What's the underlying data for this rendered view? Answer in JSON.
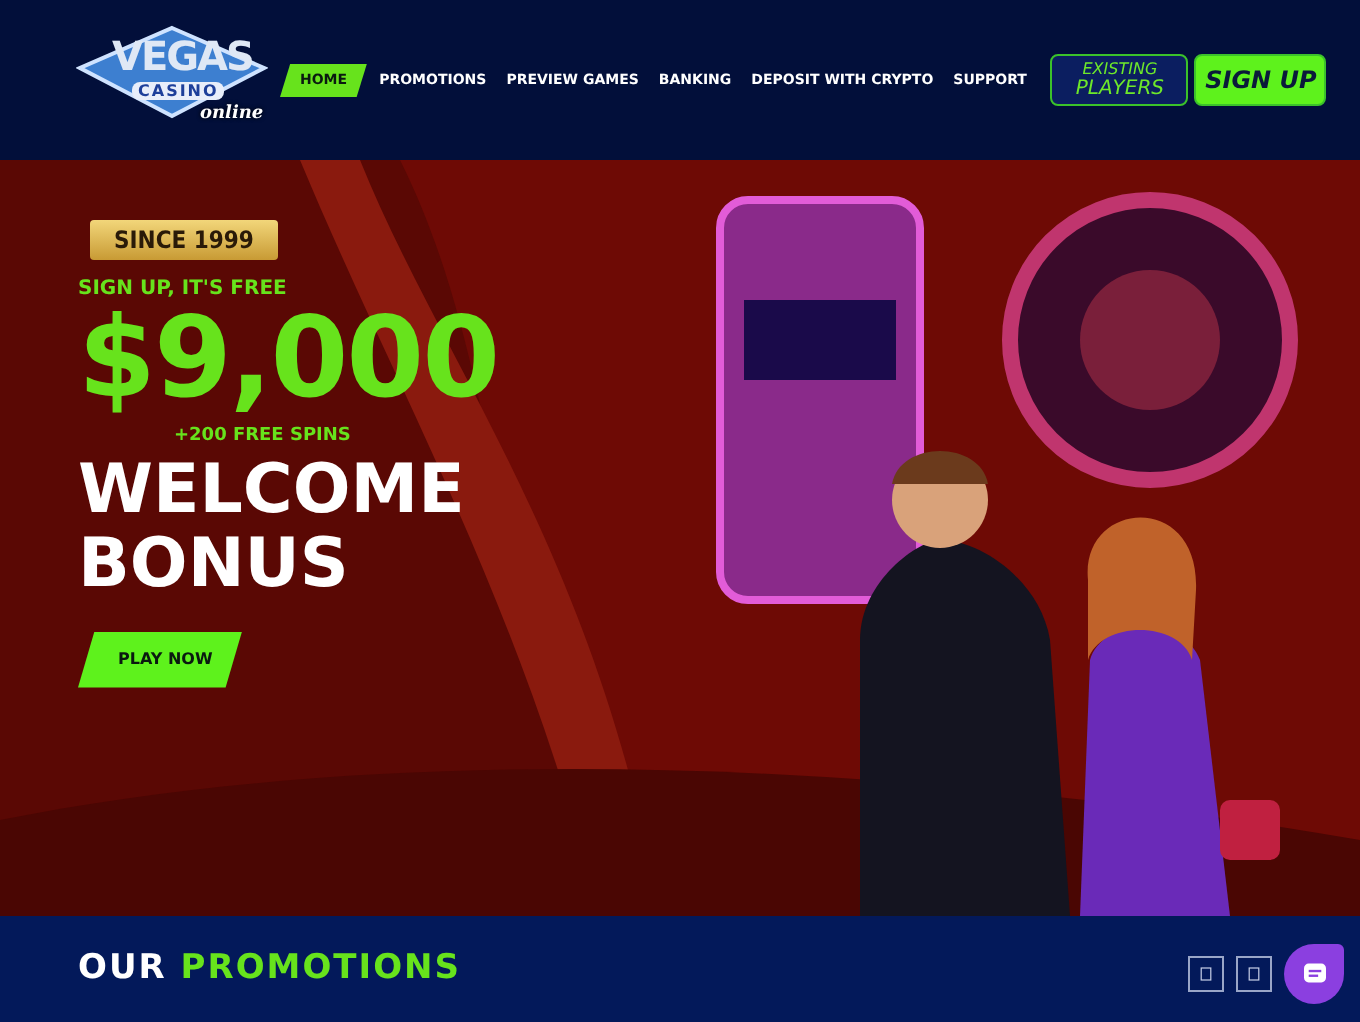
{
  "logo": {
    "word_1": "VEGAS",
    "word_2": "CASINO",
    "word_3": "online"
  },
  "nav": [
    {
      "label": "HOME",
      "selected": true
    },
    {
      "label": "PROMOTIONS",
      "selected": false
    },
    {
      "label": "PREVIEW GAMES",
      "selected": false
    },
    {
      "label": "BANKING",
      "selected": false
    },
    {
      "label": "DEPOSIT WITH CRYPTO",
      "selected": false
    },
    {
      "label": "SUPPORT",
      "selected": false
    }
  ],
  "account_buttons": [
    {
      "kind": "outline",
      "line_1": "EXISTING",
      "line_2": "PLAYERS"
    },
    {
      "kind": "filled",
      "line_1": "SIGN UP"
    }
  ],
  "hero": {
    "kind": "picture",
    "badge": "SINCE 1999",
    "kicker": "SIGN UP, IT'S FREE",
    "amount": "$9,000",
    "extra": "+200 FREE SPINS",
    "headline_1": "WELCOME",
    "headline_2": "BONUS",
    "button": "PLAY NOW"
  },
  "promotions": {
    "title_lead": "OUR",
    "title_highlight": "PROMOTIONS"
  }
}
